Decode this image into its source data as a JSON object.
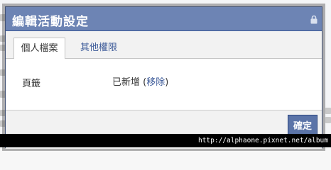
{
  "dialog": {
    "title": "編輯活動設定",
    "lock_icon": "lock-icon",
    "tabs": [
      {
        "label": "個人檔案",
        "active": true
      },
      {
        "label": "其他權限",
        "active": false
      }
    ],
    "field": {
      "label": "頁籤",
      "status_text": "已新增",
      "paren_open": "(",
      "remove_label": "移除",
      "paren_close": ")"
    },
    "confirm_label": "確定"
  },
  "watermark": "http://alphaone.pixnet.net/album",
  "colors": {
    "titlebar": "#6d84b4",
    "link": "#3b5998",
    "button": "#5b74a8",
    "footer": "#f2f2f2"
  }
}
